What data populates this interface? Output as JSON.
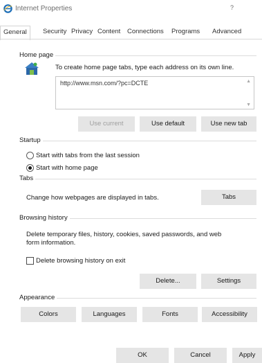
{
  "window": {
    "title": "Internet Properties",
    "help_label": "?"
  },
  "tabs": [
    {
      "label": "General",
      "active": true
    },
    {
      "label": "Security"
    },
    {
      "label": "Privacy"
    },
    {
      "label": "Content"
    },
    {
      "label": "Connections"
    },
    {
      "label": "Programs"
    },
    {
      "label": "Advanced"
    }
  ],
  "home_page": {
    "heading": "Home page",
    "instruction": "To create home page tabs, type each address on its own line.",
    "url": "http://www.msn.com/?pc=DCTE",
    "buttons": {
      "use_current": "Use current",
      "use_default": "Use default",
      "use_new_tab": "Use new tab"
    }
  },
  "startup": {
    "heading": "Startup",
    "option_last_session": "Start with tabs from the last session",
    "option_home_page": "Start with home page",
    "selected": "home_page"
  },
  "tabs_section": {
    "heading": "Tabs",
    "description": "Change how webpages are displayed in tabs.",
    "button": "Tabs"
  },
  "browsing_history": {
    "heading": "Browsing history",
    "description_line1": "Delete temporary files, history, cookies, saved passwords, and web",
    "description_line2": "form information.",
    "checkbox_label": "Delete browsing history on exit",
    "checkbox_checked": false,
    "delete_button": "Delete...",
    "settings_button": "Settings"
  },
  "appearance": {
    "heading": "Appearance",
    "colors": "Colors",
    "languages": "Languages",
    "fonts": "Fonts",
    "accessibility": "Accessibility"
  },
  "footer": {
    "ok": "OK",
    "cancel": "Cancel",
    "apply": "Apply"
  },
  "colors": {
    "ie_blue": "#1e6fb8",
    "ie_green": "#3fae49",
    "button_face": "#e5e5e5",
    "disabled_text": "#9f9f9f"
  },
  "icons": {
    "title": "internet-explorer-icon",
    "home_page": "home-page-icon"
  }
}
